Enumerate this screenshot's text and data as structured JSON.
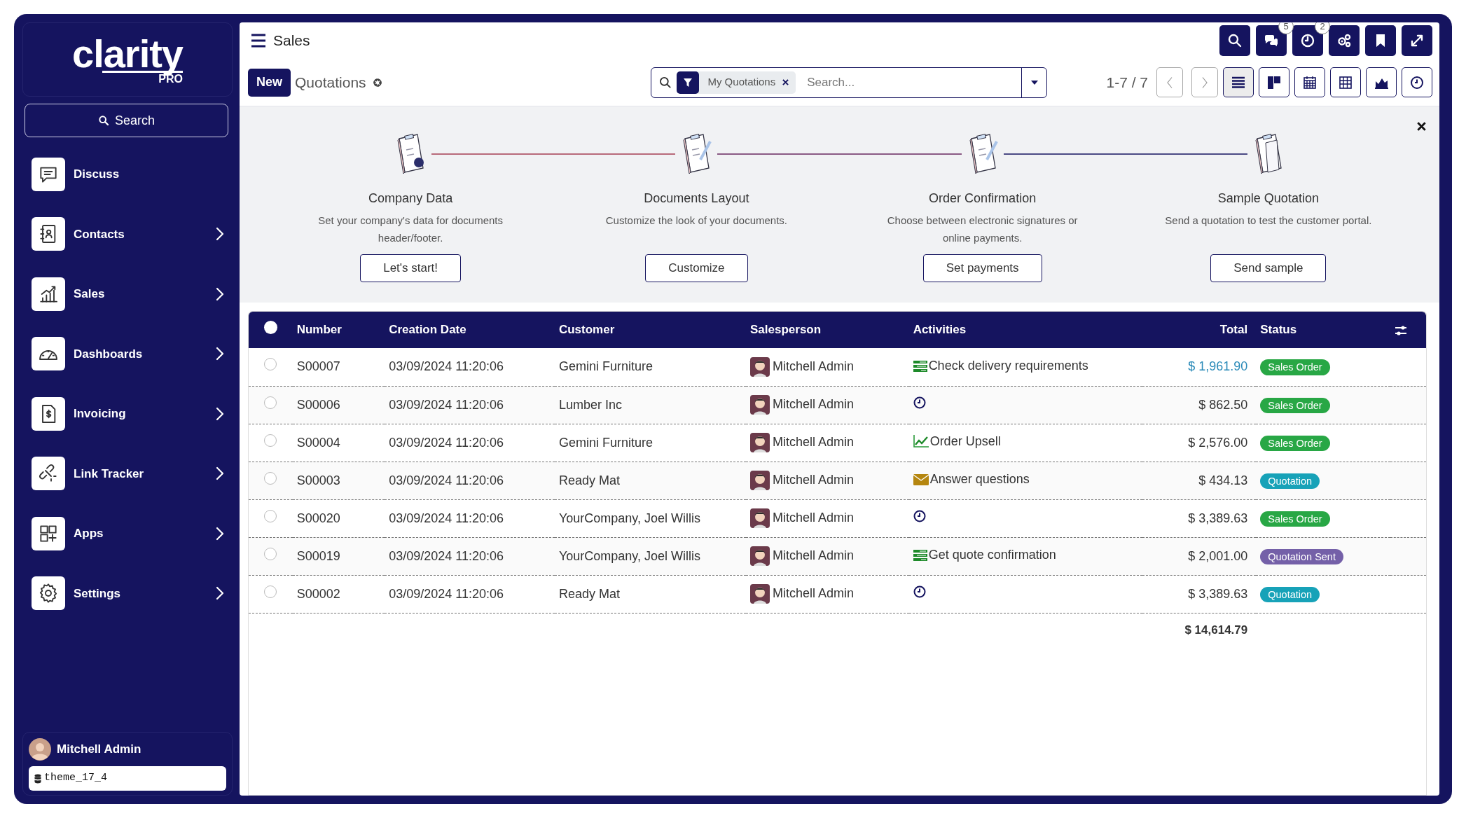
{
  "sidebar": {
    "logo": {
      "text": "clarity",
      "sub": "PRO"
    },
    "search_button": "Search",
    "items": [
      {
        "label": "Discuss",
        "kind": "discuss",
        "expandable": false
      },
      {
        "label": "Contacts",
        "kind": "contacts",
        "expandable": true
      },
      {
        "label": "Sales",
        "kind": "sales",
        "expandable": true
      },
      {
        "label": "Dashboards",
        "kind": "dashboards",
        "expandable": true
      },
      {
        "label": "Invoicing",
        "kind": "invoicing",
        "expandable": true
      },
      {
        "label": "Link Tracker",
        "kind": "link",
        "expandable": true
      },
      {
        "label": "Apps",
        "kind": "apps",
        "expandable": true
      },
      {
        "label": "Settings",
        "kind": "settings",
        "expandable": true
      }
    ],
    "user": {
      "name": "Mitchell Admin"
    },
    "database": "theme_17_4"
  },
  "topbar": {
    "title": "Sales",
    "buttons": [
      {
        "kind": "search"
      },
      {
        "kind": "chat",
        "count": "5"
      },
      {
        "kind": "clock",
        "count": "2"
      },
      {
        "kind": "gears"
      },
      {
        "kind": "bookmark"
      },
      {
        "kind": "expand"
      }
    ]
  },
  "control": {
    "new_button": "New",
    "breadcrumb": "Quotations",
    "search": {
      "facet": "My Quotations",
      "placeholder": "Search..."
    },
    "pager": "1-7 / 7",
    "views": [
      {
        "kind": "list",
        "selected": true
      },
      {
        "kind": "kanban",
        "selected": false
      },
      {
        "kind": "calendar",
        "selected": false
      },
      {
        "kind": "pivot",
        "selected": false
      },
      {
        "kind": "graph",
        "selected": false
      },
      {
        "kind": "activity",
        "selected": false
      }
    ]
  },
  "onboarding": {
    "steps": [
      {
        "title": "Company Data",
        "description": "Set your company's data for documents header/footer.",
        "button": "Let's start!"
      },
      {
        "title": "Documents Layout",
        "description": "Customize the look of your documents.",
        "button": "Customize"
      },
      {
        "title": "Order Confirmation",
        "description": "Choose between electronic signatures or online payments.",
        "button": "Set payments"
      },
      {
        "title": "Sample Quotation",
        "description": "Send a quotation to test the customer portal.",
        "button": "Send sample"
      }
    ]
  },
  "table": {
    "all_selected": false,
    "columns": [
      "Number",
      "Creation Date",
      "Customer",
      "Salesperson",
      "Activities",
      "Total",
      "Status"
    ],
    "rows": [
      {
        "selected": false,
        "number": "S00007",
        "date": "03/09/2024 11:20:06",
        "customer": "Gemini Furniture",
        "salesperson": "Mitchell Admin",
        "activity": {
          "kind": "todo",
          "text": "Check delivery requirements"
        },
        "total": "$ 1,961.90",
        "hovered": true,
        "status": {
          "label": "Sales Order",
          "color": "#28a745"
        }
      },
      {
        "selected": false,
        "number": "S00006",
        "date": "03/09/2024 11:20:06",
        "customer": "Lumber Inc",
        "salesperson": "Mitchell Admin",
        "activity": {
          "kind": "clock"
        },
        "total": "$ 862.50",
        "hovered": false,
        "status": {
          "label": "Sales Order",
          "color": "#28a745"
        }
      },
      {
        "selected": false,
        "number": "S00004",
        "date": "03/09/2024 11:20:06",
        "customer": "Gemini Furniture",
        "salesperson": "Mitchell Admin",
        "activity": {
          "kind": "upsell",
          "text": "Order Upsell"
        },
        "total": "$ 2,576.00",
        "hovered": false,
        "status": {
          "label": "Sales Order",
          "color": "#28a745"
        }
      },
      {
        "selected": false,
        "number": "S00003",
        "date": "03/09/2024 11:20:06",
        "customer": "Ready Mat",
        "salesperson": "Mitchell Admin",
        "activity": {
          "kind": "email",
          "text": "Answer questions"
        },
        "total": "$ 434.13",
        "hovered": false,
        "status": {
          "label": "Quotation",
          "color": "#17a2b8"
        }
      },
      {
        "selected": false,
        "number": "S00020",
        "date": "03/09/2024 11:20:06",
        "customer": "YourCompany, Joel Willis",
        "salesperson": "Mitchell Admin",
        "activity": {
          "kind": "clock"
        },
        "total": "$ 3,389.63",
        "hovered": false,
        "status": {
          "label": "Sales Order",
          "color": "#28a745"
        }
      },
      {
        "selected": false,
        "number": "S00019",
        "date": "03/09/2024 11:20:06",
        "customer": "YourCompany, Joel Willis",
        "salesperson": "Mitchell Admin",
        "activity": {
          "kind": "todo",
          "text": "Get quote confirmation"
        },
        "total": "$ 2,001.00",
        "hovered": false,
        "status": {
          "label": "Quotation Sent",
          "color": "#7460a8"
        }
      },
      {
        "selected": false,
        "number": "S00002",
        "date": "03/09/2024 11:20:06",
        "customer": "Ready Mat",
        "salesperson": "Mitchell Admin",
        "activity": {
          "kind": "clock"
        },
        "total": "$ 3,389.63",
        "hovered": false,
        "status": {
          "label": "Quotation",
          "color": "#17a2b8"
        }
      }
    ],
    "sum": "$ 14,614.79"
  }
}
